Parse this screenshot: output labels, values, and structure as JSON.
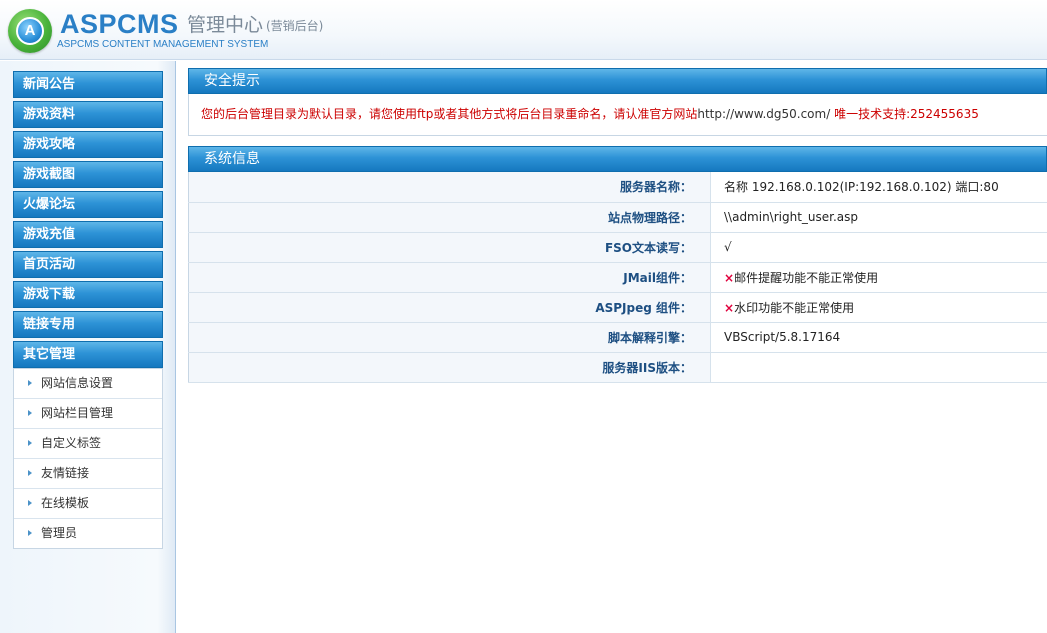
{
  "header": {
    "logo_letter": "A",
    "brand": "ASPCMS",
    "title": "管理中心",
    "subtitle": "(营销后台)",
    "tagline": "ASPCMS CONTENT MANAGEMENT SYSTEM"
  },
  "sidebar": {
    "menu": [
      {
        "label": "新闻公告"
      },
      {
        "label": "游戏资料"
      },
      {
        "label": "游戏攻略"
      },
      {
        "label": "游戏截图"
      },
      {
        "label": "火爆论坛"
      },
      {
        "label": "游戏充值"
      },
      {
        "label": "首页活动"
      },
      {
        "label": "游戏下载"
      },
      {
        "label": "链接专用"
      },
      {
        "label": "其它管理"
      }
    ],
    "submenu": [
      {
        "label": "网站信息设置"
      },
      {
        "label": "网站栏目管理"
      },
      {
        "label": "自定义标签"
      },
      {
        "label": "友情链接"
      },
      {
        "label": "在线模板"
      },
      {
        "label": "管理员"
      }
    ]
  },
  "notice": {
    "title": "安全提示",
    "message": "您的后台管理目录为默认目录，请您使用ftp或者其他方式将后台目录重命名，请认准官方网站",
    "url": "http://www.dg50.com/",
    "support": " 唯一技术支持:252455635"
  },
  "system_info": {
    "title": "系统信息",
    "rows": [
      {
        "label": "服务器名称：",
        "value": "名称 192.168.0.102(IP:192.168.0.102) 端口:80"
      },
      {
        "label": "站点物理路径：",
        "value": "\\\\admin\\right_user.asp"
      },
      {
        "label": "FSO文本读写：",
        "value": "√"
      },
      {
        "label": "JMail组件：",
        "mark": "×",
        "value": "邮件提醒功能不能正常使用"
      },
      {
        "label": "ASPJpeg 组件：",
        "mark": "×",
        "value": "水印功能不能正常使用"
      },
      {
        "label": "脚本解释引擎：",
        "value": "VBScript/5.8.17164"
      },
      {
        "label": "服务器IIS版本：",
        "value": ""
      }
    ]
  }
}
